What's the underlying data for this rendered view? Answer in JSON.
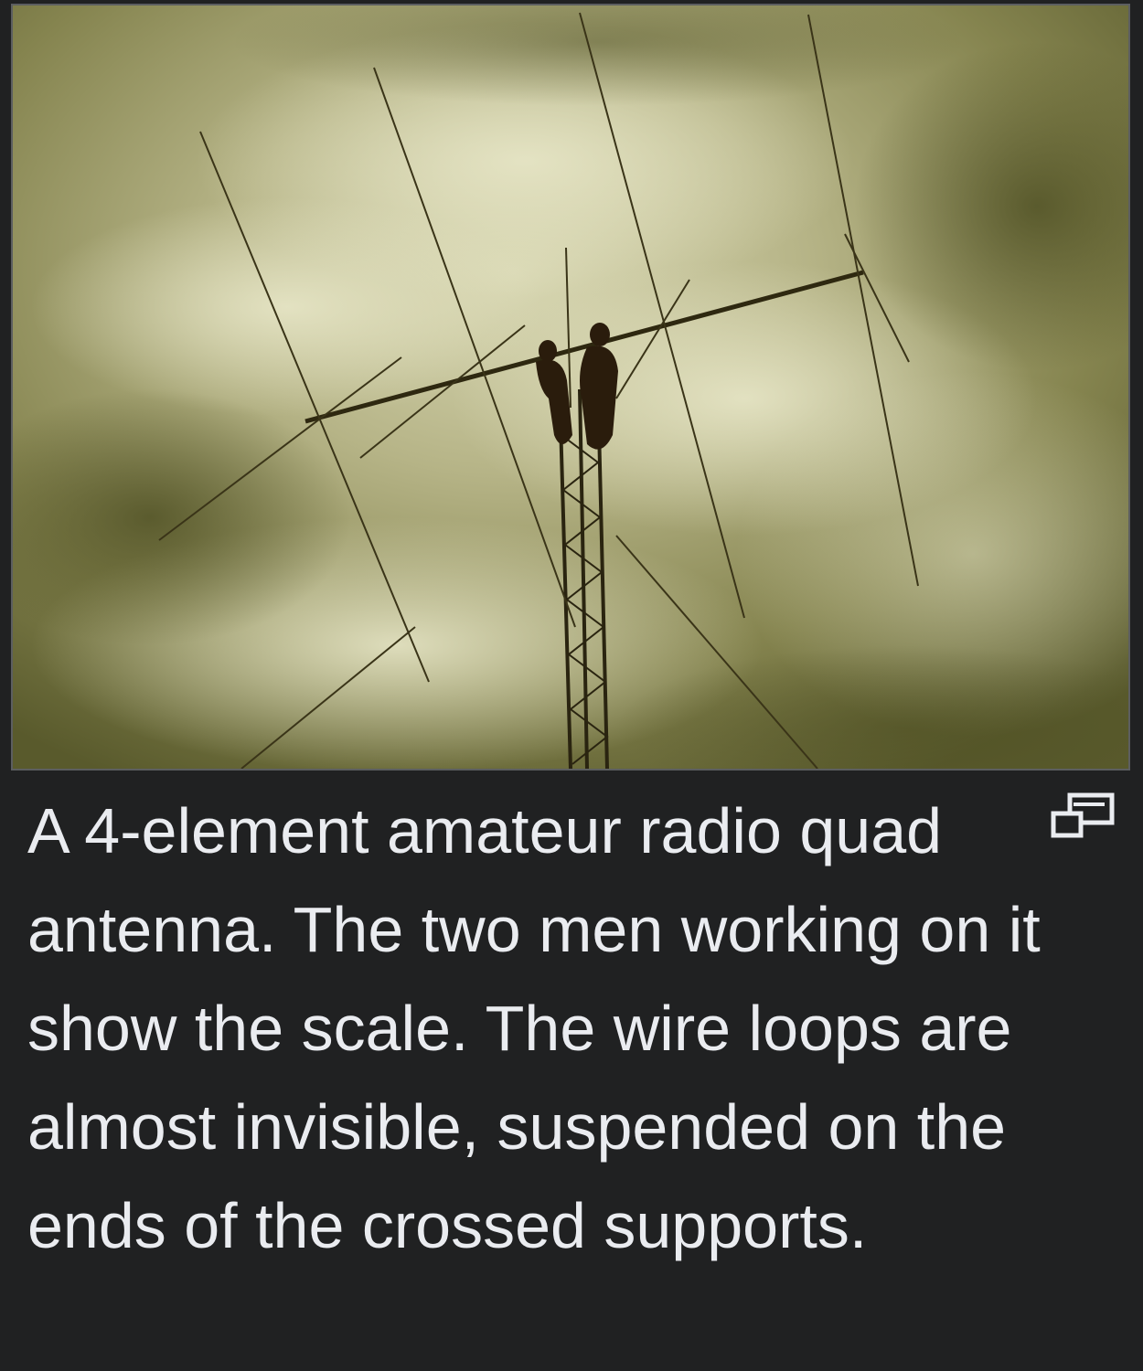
{
  "figure": {
    "image_alt": "",
    "caption": "A 4-element amateur radio quad antenna. The two men working on it show the scale. The wire loops are almost invisible, suspended on the ends of the crossed supports.",
    "enlarge_icon": "enlarge-icon",
    "colors": {
      "background": "#202122",
      "caption_text": "#eaecf0",
      "photo_tint": "#6f6e3f",
      "image_border": "#5c5e60"
    }
  }
}
